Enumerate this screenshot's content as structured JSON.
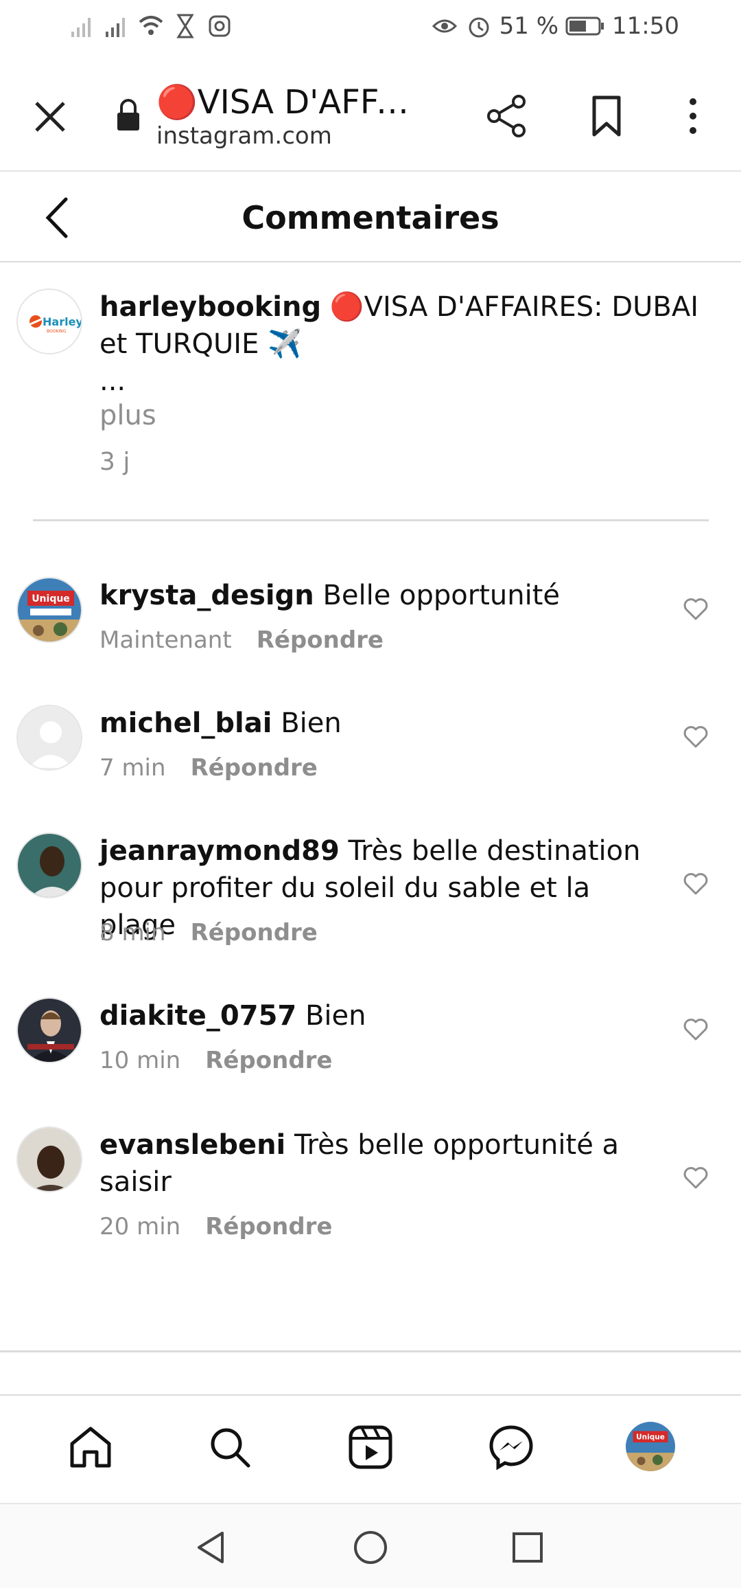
{
  "status_bar": {
    "battery": "51 %",
    "time": "11:50",
    "icons": [
      "signal-icon",
      "signal-icon",
      "wifi-icon",
      "hourglass-icon",
      "instagram-icon",
      "eye-icon",
      "alarm-icon",
      "battery-icon"
    ]
  },
  "browser": {
    "title": "🔴VISA D'AFFAIRES: DUBAI et TURQUIE ✈️",
    "domain": "instagram.com"
  },
  "header": {
    "title": "Commentaires"
  },
  "caption": {
    "username": "harleybooking",
    "text": "🔴VISA D'AFFAIRES: DUBAI et TURQUIE ✈️",
    "ellipsis": "...",
    "more": "plus",
    "time": "3 j"
  },
  "comments": [
    {
      "username": "krysta_design",
      "text": "Belle opportunité",
      "time": "Maintenant",
      "reply": "Répondre"
    },
    {
      "username": "michel_blai",
      "text": "Bien",
      "time": "7 min",
      "reply": "Répondre"
    },
    {
      "username": "jeanraymond89",
      "text": "Très belle destination pour profiter du soleil du sable et la plage",
      "time": "8 min",
      "reply": "Répondre"
    },
    {
      "username": "diakite_0757",
      "text": "Bien",
      "time": "10 min",
      "reply": "Répondre"
    },
    {
      "username": "evanslebeni",
      "text": "Très belle opportunité a saisir",
      "time": "20 min",
      "reply": "Répondre"
    }
  ],
  "nav": {
    "items": [
      "home-icon",
      "search-icon",
      "reels-icon",
      "messenger-icon",
      "profile-avatar"
    ]
  }
}
